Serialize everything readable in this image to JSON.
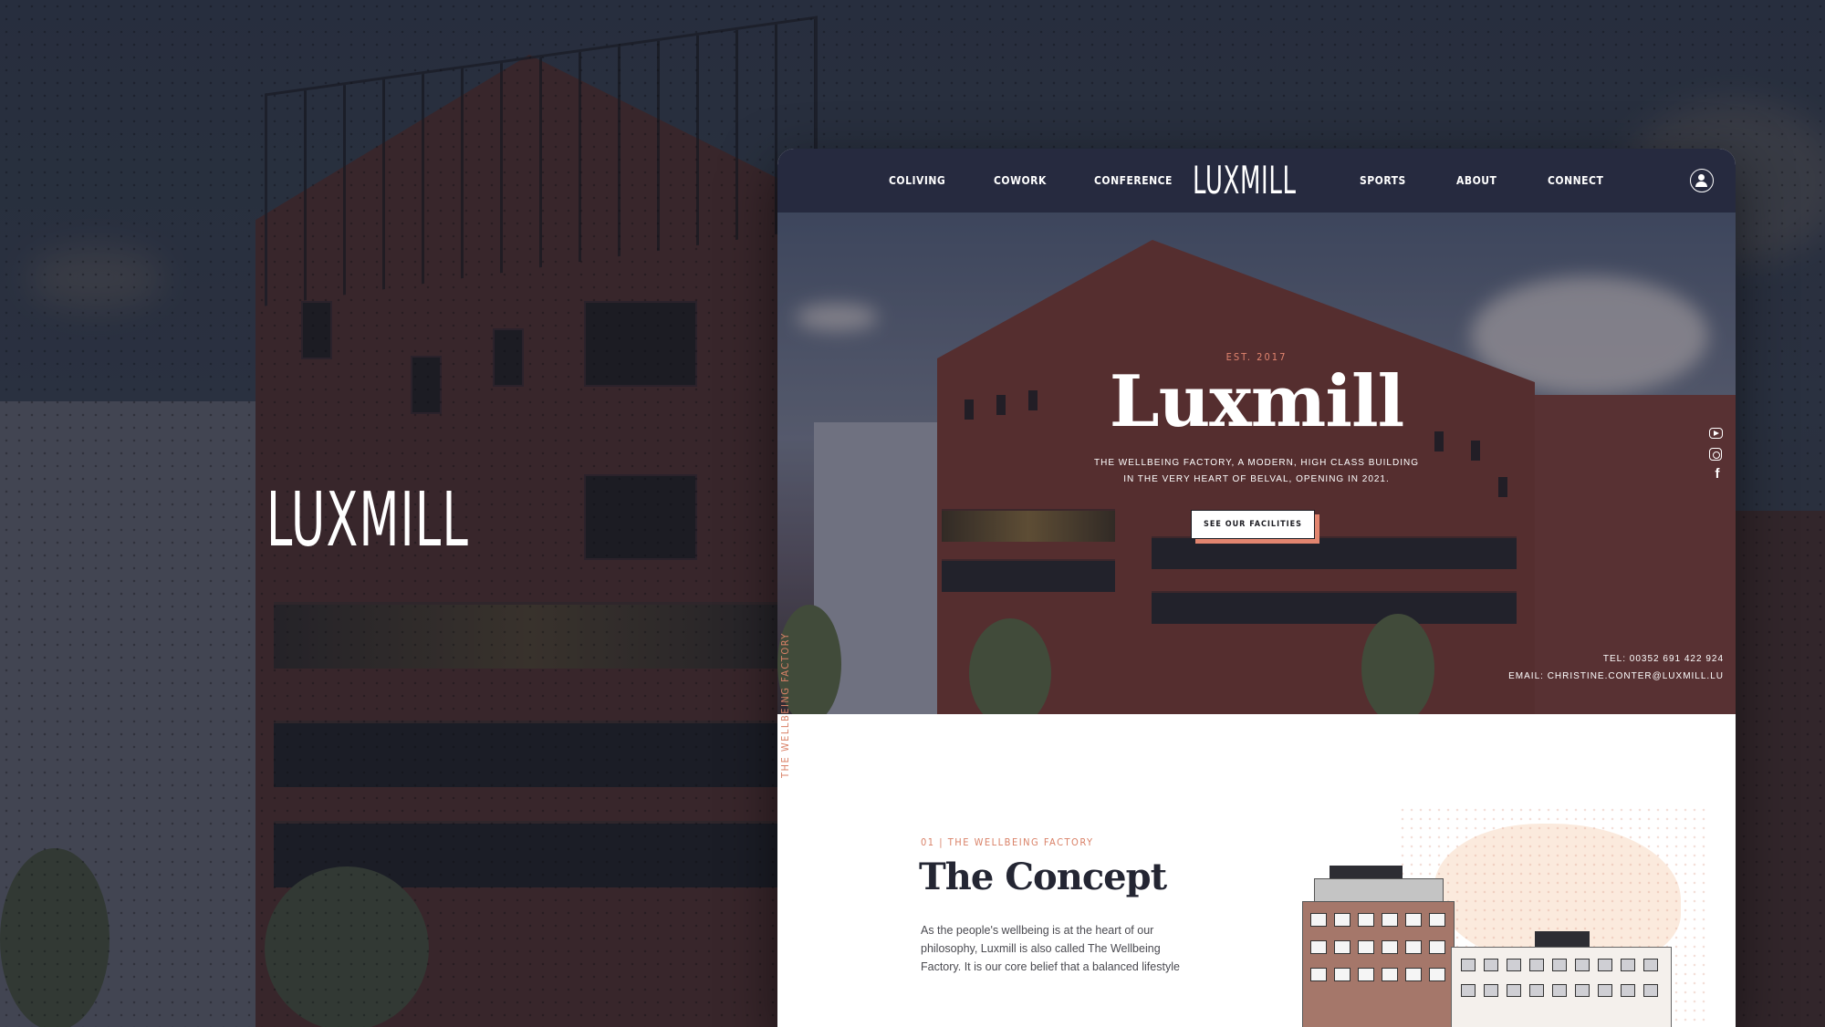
{
  "background": {
    "logo": "LUXMILL"
  },
  "nav": {
    "items_left": [
      "COLIVING",
      "COWORK",
      "CONFERENCE"
    ],
    "logo": "LUXMILL",
    "items_right": [
      "SPORTS",
      "ABOUT",
      "CONNECT"
    ],
    "user_icon": "user-icon"
  },
  "hero": {
    "est": "EST. 2017",
    "title": "Luxmill",
    "subtitle_line1": "THE WELLBEING FACTORY, A MODERN, HIGH CLASS BUILDING",
    "subtitle_line2": "IN THE VERY HEART OF BELVAL, OPENING IN 2021.",
    "cta_label": "SEE OUR FACILITIES",
    "social_icons": [
      "youtube-icon",
      "instagram-icon",
      "facebook-icon"
    ],
    "tel": "TEL: 00352 691 422 924",
    "email": "EMAIL: CHRISTINE.CONTER@LUXMILL.LU",
    "side_label": "THE WELLBEING FACTORY"
  },
  "concept": {
    "tag": "01 | THE WELLBEING FACTORY",
    "title": "The Concept",
    "body": "As the people's wellbeing is at the heart of our philosophy, Luxmill is also called The Wellbeing Factory. It is our core belief that a balanced lifestyle"
  },
  "colors": {
    "nav_bg": "#262a3f",
    "accent": "#e2856f",
    "heading": "#242633"
  }
}
